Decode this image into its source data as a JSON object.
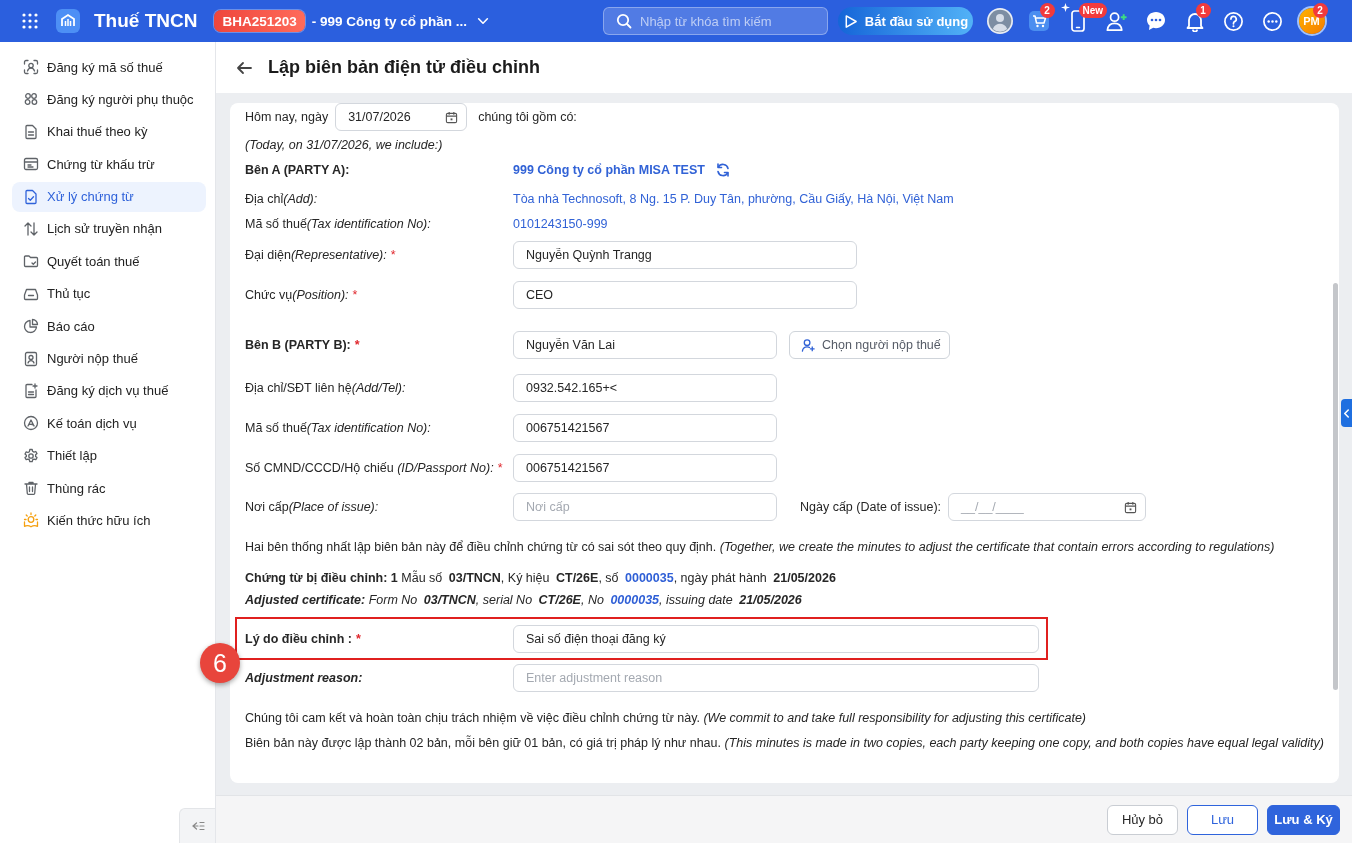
{
  "app": {
    "name": "Thuế TNCN",
    "org_code": "BHA251203",
    "org_name": "- 999 Công ty cổ phần ...",
    "search": {
      "placeholder": "Nhập từ khóa tìm kiếm"
    },
    "start_button": "Bắt đầu sử dụng",
    "cart_badge": "2",
    "phone_badge": "New",
    "bell_badge": "1",
    "profile": {
      "initials": "PM",
      "badge": "2"
    }
  },
  "sidebar": {
    "items": [
      {
        "label": "Đăng ký mã số thuế",
        "selected": false
      },
      {
        "label": "Đăng ký người phụ thuộc",
        "selected": false
      },
      {
        "label": "Khai thuế theo kỳ",
        "selected": false
      },
      {
        "label": "Chứng từ khấu trừ",
        "selected": false
      },
      {
        "label": "Xử lý chứng từ",
        "selected": true
      },
      {
        "label": "Lịch sử truyền nhận",
        "selected": false
      },
      {
        "label": "Quyết toán thuế",
        "selected": false
      },
      {
        "label": "Thủ tục",
        "selected": false
      },
      {
        "label": "Báo cáo",
        "selected": false
      },
      {
        "label": "Người nộp thuế",
        "selected": false
      },
      {
        "label": "Đăng ký dịch vụ thuế",
        "selected": false
      },
      {
        "label": "Kế toán dịch vụ",
        "selected": false
      },
      {
        "label": "Thiết lập",
        "selected": false
      },
      {
        "label": "Thùng rác",
        "selected": false
      },
      {
        "label": "Kiến thức hữu ích",
        "selected": false
      }
    ]
  },
  "page": {
    "title": "Lập biên bản điện tử điều chỉnh"
  },
  "form": {
    "date_line": {
      "before": "Hôm nay, ngày",
      "date": "31/07/2026",
      "after": "chúng tôi gồm có:"
    },
    "date_line_en": "(Today, on 31/07/2026, we include:)",
    "party_a": {
      "label": "Bên A (PARTY A):",
      "name": "999 Công ty cổ phần MISA TEST",
      "details": [
        {
          "label": "Địa chỉ",
          "label_en": "(Add):",
          "value": "Tòa nhà Technosoft, 8 Ng. 15 P. Duy Tân, phường, Cầu Giấy, Hà Nội, Việt Nam"
        },
        {
          "label": "Mã số thuế",
          "label_en": "(Tax identification No):",
          "value": "0101243150-999"
        }
      ],
      "fields": [
        {
          "label": "Đại diện",
          "label_en": "(Representative):",
          "required_mark": "*",
          "value": "Nguyễn Quỳnh Trangg"
        },
        {
          "label": "Chức vụ",
          "label_en": "(Position):",
          "required_mark": "*",
          "value": "CEO"
        }
      ]
    },
    "party_b": {
      "label": "Bên B (PARTY B):",
      "required_mark": "*",
      "value": "Nguyễn Văn Lai",
      "pick_button": "Chọn người nộp thuế",
      "fields": [
        {
          "label": "Địa chỉ/SĐT liên hệ",
          "label_en": "(Add/Tel):",
          "value": "0932.542.165+<"
        },
        {
          "label": "Mã số thuế",
          "label_en": "(Tax identification No):",
          "value": "006751421567"
        },
        {
          "label": "Số CMND/CCCD/Hộ chiếu ",
          "label_en": "(ID/Passport No):",
          "required_mark": "*",
          "value": "006751421567"
        }
      ],
      "place": {
        "label": "Nơi cấp",
        "label_en": "(Place of issue):",
        "placeholder": "Nơi cấp"
      },
      "issue_date": {
        "label": "Ngày cấp (Date of issue):",
        "placeholder": "__/__/____"
      }
    },
    "agreement": "Hai bên thống nhất lập biên bản này để điều chỉnh chứng từ có sai sót theo quy định. *(Together, we create the minutes to adjust the certificate that contain errors according to regulations)*",
    "certificate_lines": [
      {
        "kind": "vi",
        "parts": [
          {
            "text": "Chứng từ bị điều chỉnh: 1",
            "kind": "strong"
          },
          {
            "text": " Mẫu số ",
            "kind": "plain"
          },
          {
            "text": "03/TNCN",
            "kind": "strong"
          },
          {
            "text": ", Ký hiệu ",
            "kind": "plain"
          },
          {
            "text": "CT/26E",
            "kind": "strong"
          },
          {
            "text": ", số ",
            "kind": "plain"
          },
          {
            "text": "0000035",
            "kind": "number"
          },
          {
            "text": ", ngày phát hành ",
            "kind": "plain"
          },
          {
            "text": "21/05/2026",
            "kind": "strong"
          }
        ]
      },
      {
        "kind": "en",
        "parts": [
          {
            "text": "Adjusted certificate:",
            "kind": "strong"
          },
          {
            "text": " Form No ",
            "kind": "plain"
          },
          {
            "text": "03/TNCN",
            "kind": "strong"
          },
          {
            "text": ", serial No ",
            "kind": "plain"
          },
          {
            "text": "CT/26E",
            "kind": "strong"
          },
          {
            "text": ", No ",
            "kind": "plain"
          },
          {
            "text": "0000035",
            "kind": "number"
          },
          {
            "text": ", issuing date ",
            "kind": "plain"
          },
          {
            "text": "21/05/2026",
            "kind": "strong"
          }
        ]
      }
    ],
    "reason": {
      "label": "Lý do điều chỉnh :",
      "required_mark": "*",
      "value": "Sai số điện thoại đăng ký",
      "highlighted": true,
      "callout": "6"
    },
    "reason_en": {
      "label": "Adjustment reason:",
      "placeholder": "Enter adjustment reason"
    },
    "commitments": [
      "Chúng tôi cam kết và hoàn toàn chịu trách nhiệm về việc điều chỉnh chứng từ này. *(We commit to and take full responsibility for adjusting this certificate)*",
      "Biên bản này được lập thành 02 bản, mỗi bên giữ 01 bản, có giá trị pháp lý như nhau. *(This minutes is made in two copies, each party keeping one copy, and both copies have equal legal validity)*"
    ]
  },
  "footer": {
    "buttons": [
      {
        "label": "Hủy bỏ",
        "kind": "default"
      },
      {
        "label": "Lưu",
        "kind": "outline"
      },
      {
        "label": "Lưu & Ký",
        "kind": "primary"
      }
    ]
  }
}
